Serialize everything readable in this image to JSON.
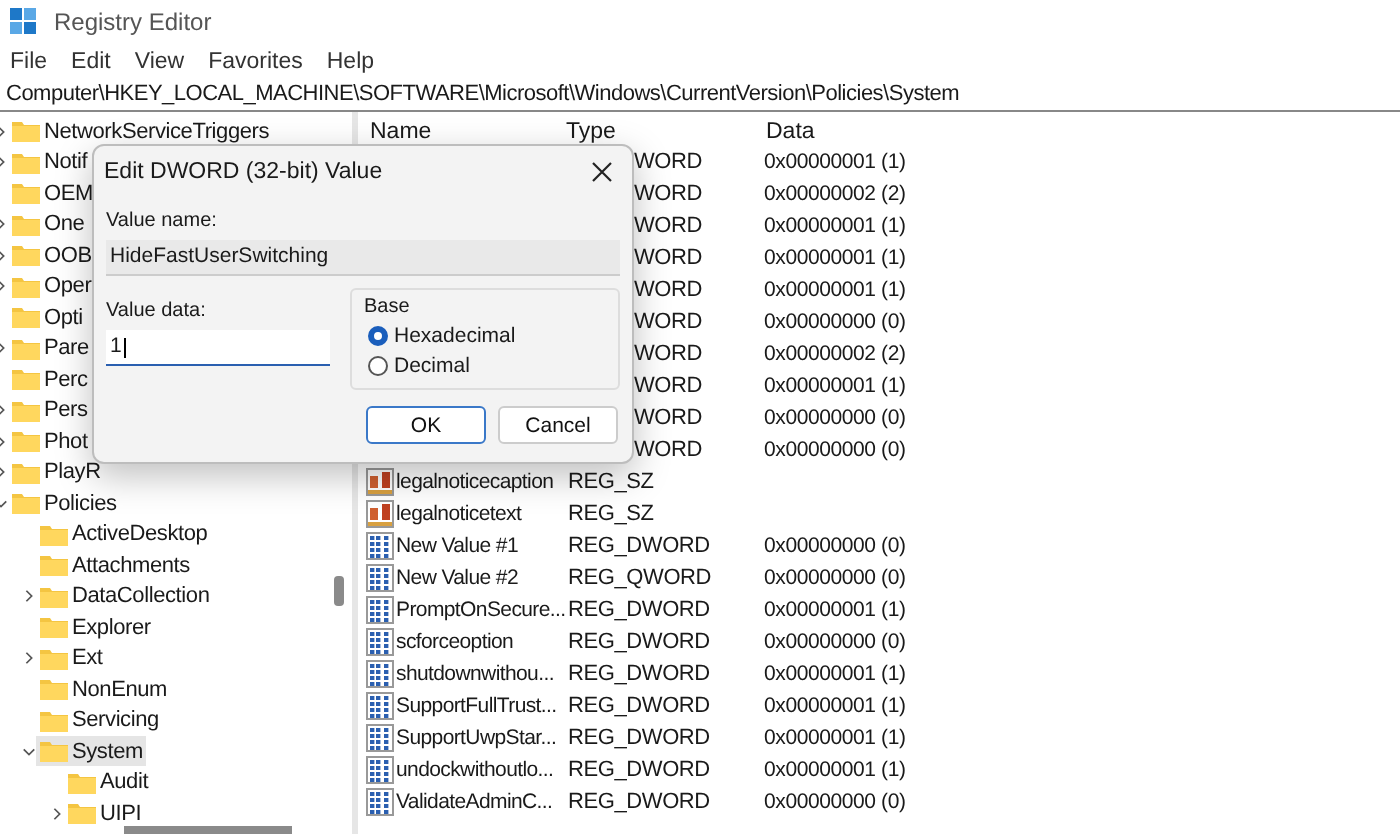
{
  "window": {
    "title": "Registry Editor"
  },
  "menu": [
    "File",
    "Edit",
    "View",
    "Favorites",
    "Help"
  ],
  "address": "Computer\\HKEY_LOCAL_MACHINE\\SOFTWARE\\Microsoft\\Windows\\CurrentVersion\\Policies\\System",
  "tree": [
    {
      "label": "NetworkServiceTriggers",
      "expanded": false,
      "selected": false
    },
    {
      "label": "Notif",
      "expanded": false,
      "selected": false
    },
    {
      "label": "OEM",
      "selected": false
    },
    {
      "label": "One",
      "expanded": false,
      "selected": false
    },
    {
      "label": "OOB",
      "expanded": false,
      "selected": false
    },
    {
      "label": "Oper",
      "expanded": false,
      "selected": false
    },
    {
      "label": "Opti",
      "selected": false
    },
    {
      "label": "Pare",
      "expanded": false,
      "selected": false
    },
    {
      "label": "Perc",
      "selected": false
    },
    {
      "label": "Pers",
      "expanded": false,
      "selected": false
    },
    {
      "label": "Phot",
      "expanded": false,
      "selected": false
    },
    {
      "label": "PlayR",
      "expanded": false,
      "selected": false
    },
    {
      "label": "Policies",
      "expanded": true,
      "selected": false,
      "children": [
        {
          "label": "ActiveDesktop",
          "selected": false
        },
        {
          "label": "Attachments",
          "selected": false
        },
        {
          "label": "DataCollection",
          "expanded": false,
          "selected": false
        },
        {
          "label": "Explorer",
          "selected": false
        },
        {
          "label": "Ext",
          "expanded": false,
          "selected": false
        },
        {
          "label": "NonEnum",
          "selected": false
        },
        {
          "label": "Servicing",
          "selected": false
        },
        {
          "label": "System",
          "expanded": true,
          "selected": true,
          "children": [
            {
              "label": "Audit",
              "selected": false
            },
            {
              "label": "UIPI",
              "expanded": false,
              "selected": false
            }
          ]
        }
      ]
    }
  ],
  "columns": [
    "Name",
    "Type",
    "Data"
  ],
  "values": [
    {
      "type": "WORD",
      "data": "0x00000001 (1)"
    },
    {
      "type": "WORD",
      "data": "0x00000002 (2)"
    },
    {
      "type": "WORD",
      "data": "0x00000001 (1)"
    },
    {
      "type": "WORD",
      "data": "0x00000001 (1)"
    },
    {
      "type": "WORD",
      "data": "0x00000001 (1)"
    },
    {
      "type": "WORD",
      "data": "0x00000000 (0)"
    },
    {
      "type": "WORD",
      "data": "0x00000002 (2)"
    },
    {
      "type": "WORD",
      "data": "0x00000001 (1)"
    },
    {
      "type": "WORD",
      "data": "0x00000000 (0)"
    },
    {
      "type": "WORD",
      "data": "0x00000000 (0)"
    },
    {
      "kind": "string",
      "name": "legalnoticecaption",
      "type": "REG_SZ"
    },
    {
      "kind": "string",
      "name": "legalnoticetext",
      "type": "REG_SZ"
    },
    {
      "kind": "binary",
      "name": "New Value #1",
      "type": "REG_DWORD",
      "data": "0x00000000 (0)"
    },
    {
      "kind": "binary",
      "name": "New Value #2",
      "type": "REG_QWORD",
      "data": "0x00000000 (0)"
    },
    {
      "kind": "binary",
      "name": "PromptOnSecure...",
      "type": "REG_DWORD",
      "data": "0x00000001 (1)"
    },
    {
      "kind": "binary",
      "name": "scforceoption",
      "type": "REG_DWORD",
      "data": "0x00000000 (0)"
    },
    {
      "kind": "binary",
      "name": "shutdownwithou...",
      "type": "REG_DWORD",
      "data": "0x00000001 (1)"
    },
    {
      "kind": "binary",
      "name": "SupportFullTrust...",
      "type": "REG_DWORD",
      "data": "0x00000001 (1)"
    },
    {
      "kind": "binary",
      "name": "SupportUwpStar...",
      "type": "REG_DWORD",
      "data": "0x00000001 (1)"
    },
    {
      "kind": "binary",
      "name": "undockwithoutlo...",
      "type": "REG_DWORD",
      "data": "0x00000001 (1)"
    },
    {
      "kind": "binary",
      "name": "ValidateAdminC...",
      "type": "REG_DWORD",
      "data": "0x00000000 (0)"
    }
  ],
  "dialog": {
    "title": "Edit DWORD (32-bit) Value",
    "name_label": "Value name:",
    "name_value": "HideFastUserSwitching",
    "data_label": "Value data:",
    "data_value": "1",
    "base_label": "Base",
    "base_options": [
      {
        "label": "Hexadecimal",
        "selected": true
      },
      {
        "label": "Decimal",
        "selected": false
      }
    ],
    "buttons": [
      {
        "label": "OK",
        "default": true
      },
      {
        "label": "Cancel",
        "default": false
      }
    ]
  }
}
